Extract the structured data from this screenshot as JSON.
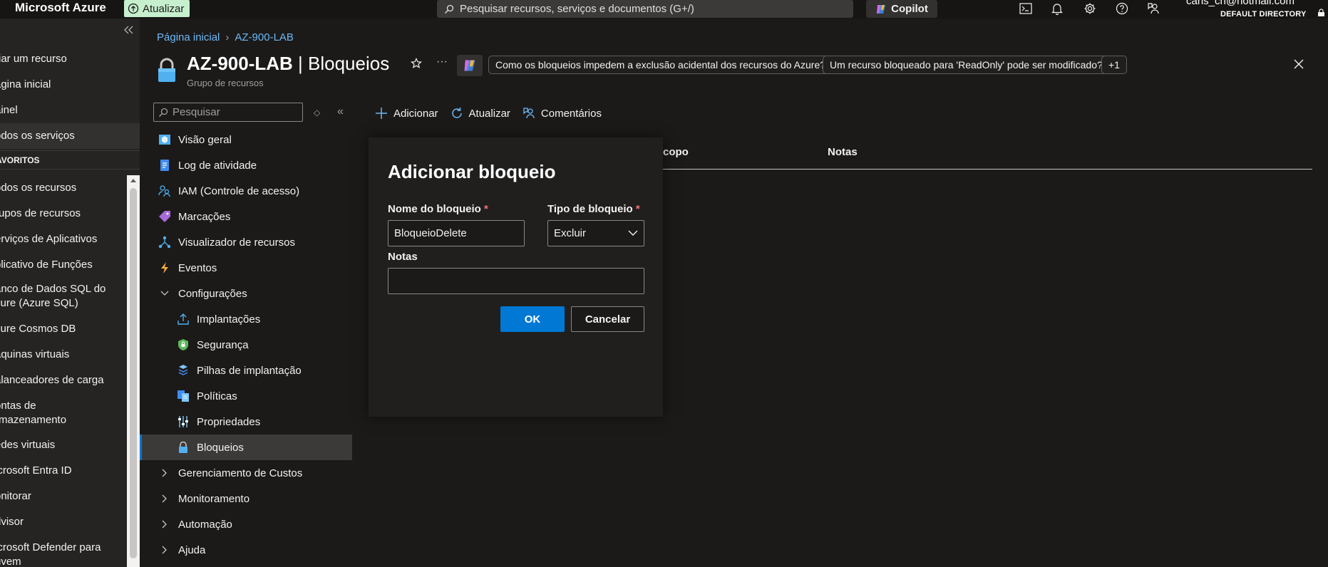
{
  "topbar": {
    "brand": "Microsoft Azure",
    "update_label": "Atualizar",
    "search_placeholder": "Pesquisar recursos, serviços e documentos (G+/)",
    "copilot_label": "Copilot",
    "user_email": "carls_ch@hotmail.com",
    "user_directory": "DEFAULT DIRECTORY",
    "icons": [
      "cloud-shell-icon",
      "bell-icon",
      "gear-icon",
      "help-icon",
      "feedback-icon"
    ]
  },
  "leftnav": {
    "items": [
      "riar um recurso",
      "ágina inicial",
      "ainel",
      "odos os serviços"
    ],
    "favorites_label": "AVORITOS",
    "favorites": [
      "odos os recursos",
      "rupos de recursos",
      "erviços de Aplicativos",
      "plicativo de Funções",
      "anco de Dados SQL do\nzure (Azure SQL)",
      "zure Cosmos DB",
      "áquinas virtuais",
      "alanceadores de carga",
      "ontas de\nrmazenamento",
      "edes virtuais",
      "icrosoft Entra ID",
      "onitorar",
      "dvisor",
      "icrosoft Defender para\nuvem"
    ]
  },
  "header": {
    "breadcrumb": [
      "Página inicial",
      "AZ-900-LAB"
    ],
    "title_resource": "AZ-900-LAB",
    "title_sep": " | ",
    "title_page": "Bloqueios",
    "subtitle": "Grupo de recursos",
    "chips": [
      "Como os bloqueios impedem a exclusão acidental dos recursos do Azure?",
      "Um recurso bloqueado para 'ReadOnly' pode ser modificado?",
      "+1"
    ]
  },
  "resource_menu": {
    "search_placeholder": "Pesquisar",
    "items": {
      "overview": "Visão geral",
      "activity_log": "Log de atividade",
      "iam": "IAM (Controle de acesso)",
      "tags": "Marcações",
      "resource_visualizer": "Visualizador de recursos",
      "events": "Eventos",
      "settings": "Configurações",
      "deployments": "Implantações",
      "security": "Segurança",
      "deployment_stacks": "Pilhas de implantação",
      "policies": "Políticas",
      "properties": "Propriedades",
      "locks": "Bloqueios",
      "cost_management": "Gerenciamento de Custos",
      "monitoring": "Monitoramento",
      "automation": "Automação",
      "help": "Ajuda"
    }
  },
  "commands": {
    "add": "Adicionar",
    "refresh": "Atualizar",
    "feedback": "Comentários"
  },
  "table": {
    "col_scope_partial": "copo",
    "col_notes": "Notas"
  },
  "dialog": {
    "title": "Adicionar bloqueio",
    "name_label": "Nome do bloqueio",
    "name_value": "BloqueioDelete",
    "type_label": "Tipo de bloqueio",
    "type_value": "Excluir",
    "required_mark": "*",
    "notes_label": "Notas",
    "notes_value": "",
    "ok_label": "OK",
    "cancel_label": "Cancelar"
  },
  "colors": {
    "accent": "#0078d4",
    "link": "#6cb8f6",
    "update_bg": "#c6efce",
    "required": "#f1707b"
  }
}
